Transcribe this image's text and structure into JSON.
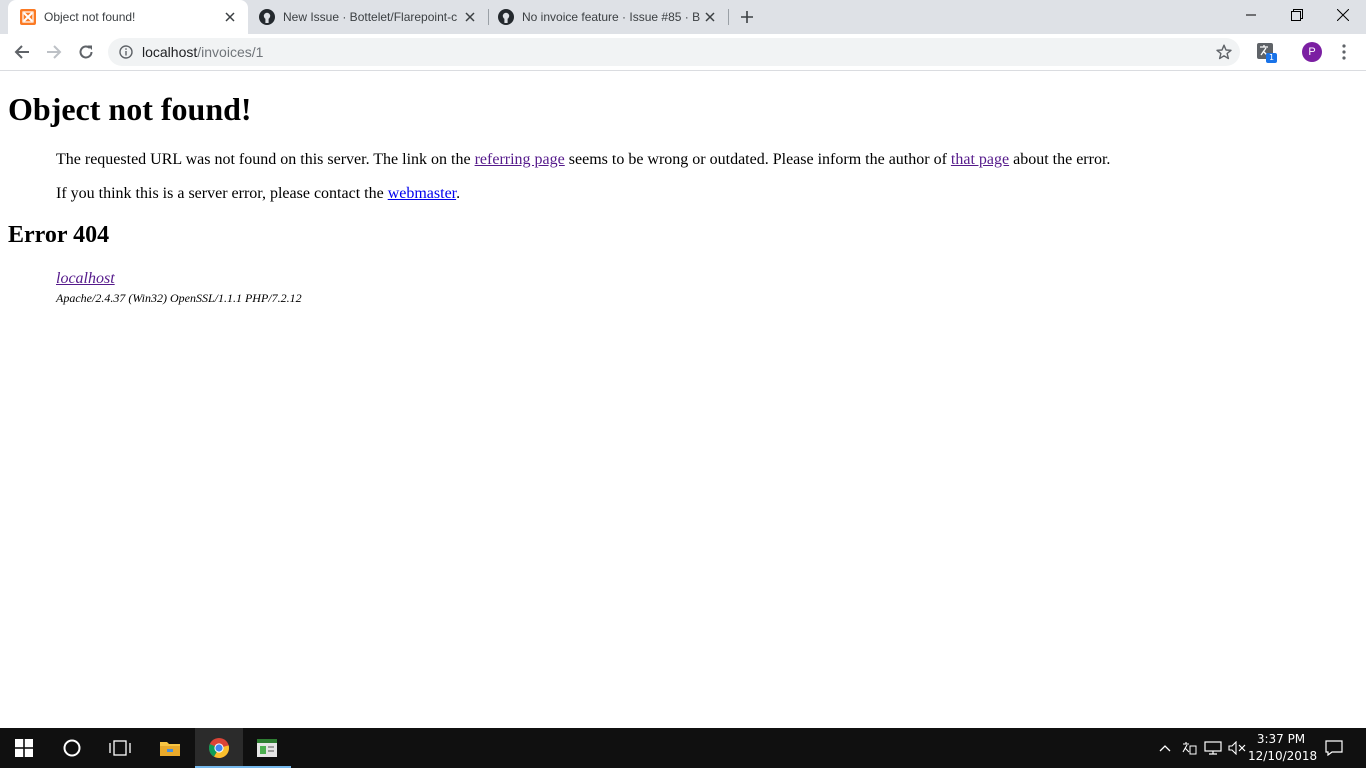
{
  "tabs": [
    {
      "title": "Object not found!",
      "active": true
    },
    {
      "title": "New Issue · Bottelet/Flarepoint-c"
    },
    {
      "title": "No invoice feature · Issue #85 · B"
    }
  ],
  "toolbar": {
    "url_host": "localhost",
    "url_path": "/invoices/1",
    "extension_badge": "1",
    "profile_initial": "P"
  },
  "page": {
    "title": "Object not found!",
    "p1_before": "The requested URL was not found on this server. The link on the ",
    "p1_link1": "referring page",
    "p1_middle": " seems to be wrong or outdated. Please inform the author of ",
    "p1_link2": "that page",
    "p1_after": " about the error.",
    "p2_before": "If you think this is a server error, please contact the ",
    "p2_link": "webmaster",
    "p2_after": ".",
    "error_heading": "Error 404",
    "address_link": "localhost",
    "server_signature": "Apache/2.4.37 (Win32) OpenSSL/1.1.1 PHP/7.2.12"
  },
  "taskbar": {
    "time": "3:37 PM",
    "date": "12/10/2018"
  },
  "colors": {
    "tabstrip_bg": "#dee1e6",
    "visited_link": "#551a8b",
    "unvisited_link": "#0000ee",
    "taskbar_bg": "#101010",
    "xampp_orange": "#fb7a24",
    "profile_purple": "#7b1fa2"
  }
}
